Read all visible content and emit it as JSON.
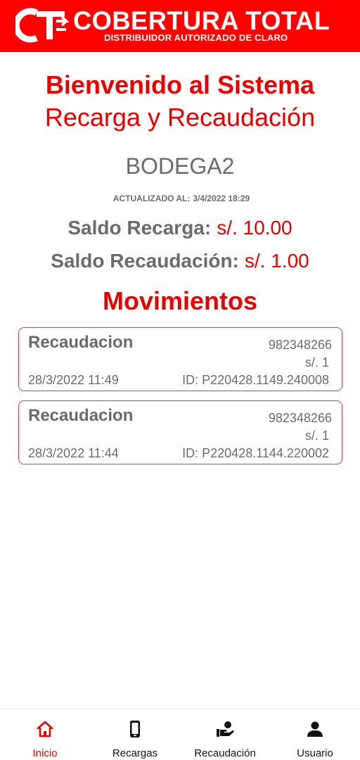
{
  "header": {
    "brand_title": "COBERTURA TOTAL",
    "brand_subtitle": "DISTRIBUIDOR AUTORIZADO DE CLARO",
    "logo_text": "CT",
    "background_color": "#ff0000"
  },
  "welcome": {
    "title": "Bienvenido al Sistema",
    "subtitle": "Recarga y Recaudación"
  },
  "store": {
    "name": "BODEGA2",
    "updated_label": "ACTUALIZADO AL:",
    "updated_value": "3/4/2022 18:29"
  },
  "balances": {
    "recarga_label": "Saldo Recarga:",
    "recarga_value": "s/. 10.00",
    "recaudacion_label": "Saldo Recaudación:",
    "recaudacion_value": "s/. 1.00"
  },
  "movements": {
    "title": "Movimientos",
    "items": [
      {
        "type": "Recaudacion",
        "phone": "982348266",
        "amount": "s/. 1",
        "date": "28/3/2022 11:49",
        "id": "ID: P220428.1149.240008"
      },
      {
        "type": "Recaudacion",
        "phone": "982348266",
        "amount": "s/. 1",
        "date": "28/3/2022 11:44",
        "id": "ID: P220428.1144.220002"
      }
    ]
  },
  "nav": {
    "items": [
      {
        "label": "Inicio",
        "icon": "home-icon",
        "active": true
      },
      {
        "label": "Recargas",
        "icon": "phone-icon",
        "active": false
      },
      {
        "label": "Recaudación",
        "icon": "hand-coin-icon",
        "active": false
      },
      {
        "label": "Usuario",
        "icon": "user-icon",
        "active": false
      }
    ]
  },
  "colors": {
    "accent": "#e60000",
    "text_gray": "#6b6b6b",
    "card_border": "#e23b3b"
  }
}
